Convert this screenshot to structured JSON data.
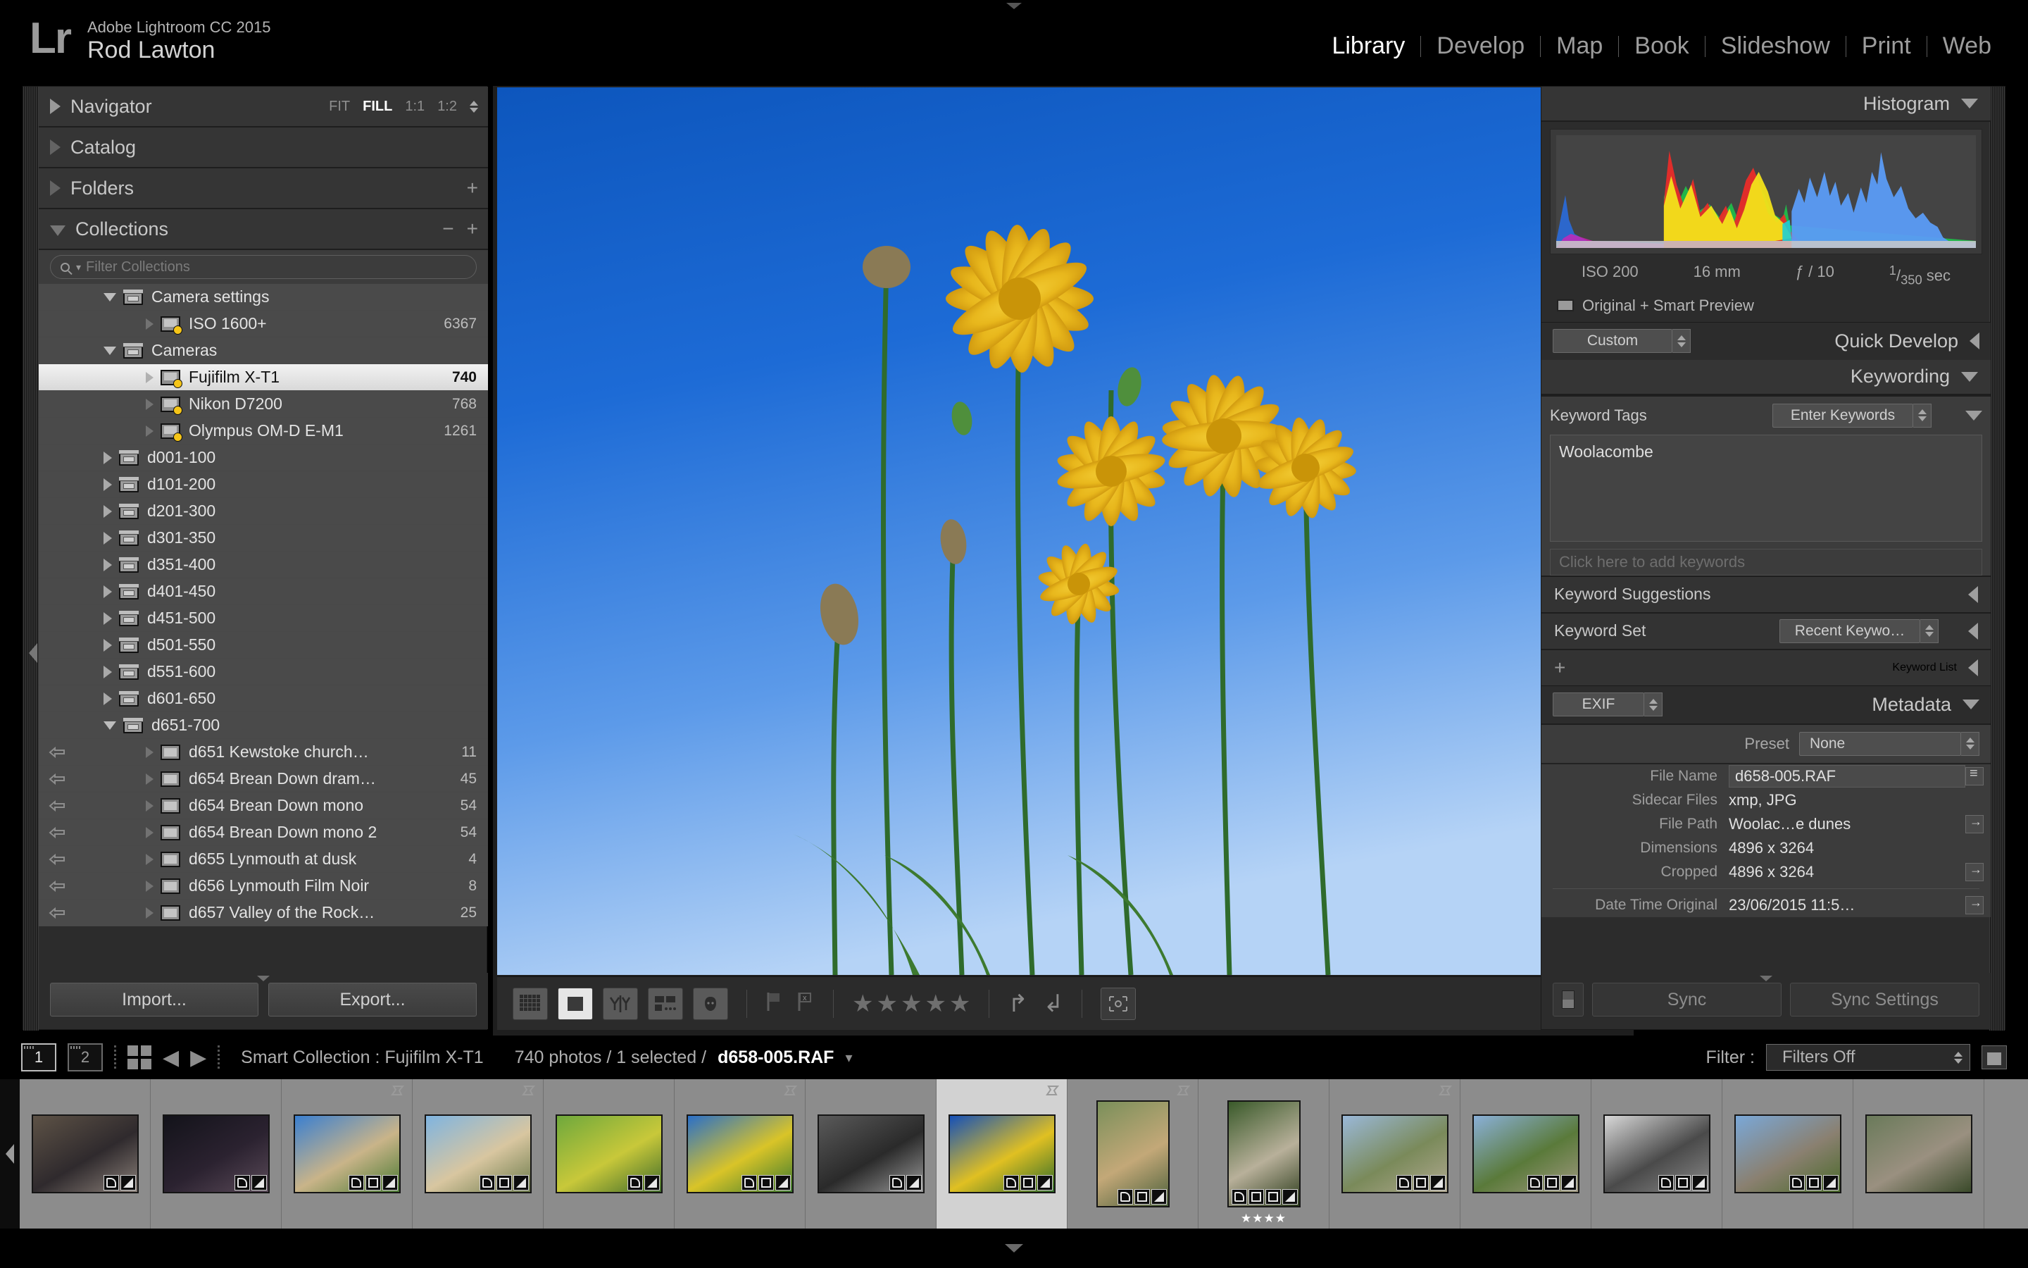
{
  "app": {
    "logo": "Lr",
    "product": "Adobe Lightroom CC 2015",
    "user": "Rod Lawton"
  },
  "modules": [
    {
      "label": "Library",
      "active": true
    },
    {
      "label": "Develop",
      "active": false
    },
    {
      "label": "Map",
      "active": false
    },
    {
      "label": "Book",
      "active": false
    },
    {
      "label": "Slideshow",
      "active": false
    },
    {
      "label": "Print",
      "active": false
    },
    {
      "label": "Web",
      "active": false
    }
  ],
  "left_panel": {
    "navigator": {
      "title": "Navigator",
      "zoom_options": [
        {
          "label": "FIT",
          "active": false
        },
        {
          "label": "FILL",
          "active": true
        },
        {
          "label": "1:1",
          "active": false
        },
        {
          "label": "1:2",
          "active": false
        }
      ]
    },
    "catalog": {
      "title": "Catalog"
    },
    "folders": {
      "title": "Folders"
    },
    "collections": {
      "title": "Collections",
      "filter_placeholder": "Filter Collections",
      "items": [
        {
          "label": "Camera settings",
          "count": "",
          "type": "set",
          "twist": "down",
          "indent": 1,
          "selected": false,
          "sync": false
        },
        {
          "label": "ISO 1600+",
          "count": "6367",
          "type": "smart",
          "twist": "dot",
          "indent": 2,
          "selected": false,
          "sync": false
        },
        {
          "label": "Cameras",
          "count": "",
          "type": "set",
          "twist": "down",
          "indent": 1,
          "selected": false,
          "sync": false
        },
        {
          "label": "Fujifilm X-T1",
          "count": "740",
          "type": "smart",
          "twist": "dot",
          "indent": 2,
          "selected": true,
          "sync": false
        },
        {
          "label": "Nikon D7200",
          "count": "768",
          "type": "smart",
          "twist": "dot",
          "indent": 2,
          "selected": false,
          "sync": false
        },
        {
          "label": "Olympus OM-D E-M1",
          "count": "1261",
          "type": "smart",
          "twist": "dot",
          "indent": 2,
          "selected": false,
          "sync": false
        },
        {
          "label": "d001-100",
          "count": "",
          "type": "set",
          "twist": "right",
          "indent": 1,
          "selected": false,
          "sync": false
        },
        {
          "label": "d101-200",
          "count": "",
          "type": "set",
          "twist": "right",
          "indent": 1,
          "selected": false,
          "sync": false
        },
        {
          "label": "d201-300",
          "count": "",
          "type": "set",
          "twist": "right",
          "indent": 1,
          "selected": false,
          "sync": false
        },
        {
          "label": "d301-350",
          "count": "",
          "type": "set",
          "twist": "right",
          "indent": 1,
          "selected": false,
          "sync": false
        },
        {
          "label": "d351-400",
          "count": "",
          "type": "set",
          "twist": "right",
          "indent": 1,
          "selected": false,
          "sync": false
        },
        {
          "label": "d401-450",
          "count": "",
          "type": "set",
          "twist": "right",
          "indent": 1,
          "selected": false,
          "sync": false
        },
        {
          "label": "d451-500",
          "count": "",
          "type": "set",
          "twist": "right",
          "indent": 1,
          "selected": false,
          "sync": false
        },
        {
          "label": "d501-550",
          "count": "",
          "type": "set",
          "twist": "right",
          "indent": 1,
          "selected": false,
          "sync": false
        },
        {
          "label": "d551-600",
          "count": "",
          "type": "set",
          "twist": "right",
          "indent": 1,
          "selected": false,
          "sync": false
        },
        {
          "label": "d601-650",
          "count": "",
          "type": "set",
          "twist": "right",
          "indent": 1,
          "selected": false,
          "sync": false
        },
        {
          "label": "d651-700",
          "count": "",
          "type": "set",
          "twist": "down",
          "indent": 1,
          "selected": false,
          "sync": false
        },
        {
          "label": "d651 Kewstoke church…",
          "count": "11",
          "type": "coll",
          "twist": "dot",
          "indent": 2,
          "selected": false,
          "sync": true
        },
        {
          "label": "d654 Brean Down dram…",
          "count": "45",
          "type": "coll",
          "twist": "dot",
          "indent": 2,
          "selected": false,
          "sync": true
        },
        {
          "label": "d654 Brean Down mono",
          "count": "54",
          "type": "coll",
          "twist": "dot",
          "indent": 2,
          "selected": false,
          "sync": true
        },
        {
          "label": "d654 Brean Down mono 2",
          "count": "54",
          "type": "coll",
          "twist": "dot",
          "indent": 2,
          "selected": false,
          "sync": true
        },
        {
          "label": "d655 Lynmouth at dusk",
          "count": "4",
          "type": "coll",
          "twist": "dot",
          "indent": 2,
          "selected": false,
          "sync": true
        },
        {
          "label": "d656 Lynmouth Film Noir",
          "count": "8",
          "type": "coll",
          "twist": "dot",
          "indent": 2,
          "selected": false,
          "sync": true
        },
        {
          "label": "d657 Valley of the Rock…",
          "count": "25",
          "type": "coll",
          "twist": "dot",
          "indent": 2,
          "selected": false,
          "sync": true
        }
      ]
    },
    "import_label": "Import...",
    "export_label": "Export..."
  },
  "toolbar": {
    "views": [
      {
        "name": "grid-view",
        "active": false
      },
      {
        "name": "loupe-view",
        "active": true
      },
      {
        "name": "compare-view",
        "active": false
      },
      {
        "name": "survey-view",
        "active": false
      },
      {
        "name": "people-view",
        "active": false
      }
    ],
    "flag_label": "flag",
    "reject_label": "reject",
    "stars": "★★★★★",
    "rotate_left": "↰",
    "rotate_right": "↲"
  },
  "right_panel": {
    "histogram": {
      "title": "Histogram",
      "iso": "ISO 200",
      "focal": "16 mm",
      "aperture": "ƒ / 10",
      "shutter_num": "1",
      "shutter_den": "350",
      "shutter_unit": "sec",
      "preview_state": "Original + Smart Preview"
    },
    "quick_develop": {
      "title": "Quick Develop",
      "preset": "Custom"
    },
    "keywording": {
      "title": "Keywording",
      "tags_label": "Keyword Tags",
      "tags_mode": "Enter Keywords",
      "keywords": "Woolacombe",
      "add_placeholder": "Click here to add keywords",
      "suggestions_title": "Keyword Suggestions",
      "set_label": "Keyword Set",
      "set_value": "Recent Keywo…"
    },
    "keyword_list": {
      "title": "Keyword List",
      "add": "+"
    },
    "metadata": {
      "title": "Metadata",
      "mode": "EXIF",
      "preset_label": "Preset",
      "preset_value": "None",
      "fields": [
        {
          "key": "File Name",
          "value": "d658-005.RAF",
          "boxed": true,
          "button": "list"
        },
        {
          "key": "Sidecar Files",
          "value": "xmp, JPG",
          "boxed": false,
          "button": ""
        },
        {
          "key": "File Path",
          "value": "Woolac…e dunes",
          "boxed": false,
          "button": "arrow"
        },
        {
          "key": "Dimensions",
          "value": "4896 x 3264",
          "boxed": false,
          "button": ""
        },
        {
          "key": "Cropped",
          "value": "4896 x 3264",
          "boxed": false,
          "button": "arrow"
        },
        {
          "key": "Date Time Original",
          "value": "23/06/2015 11:5…",
          "boxed": false,
          "button": "arrow"
        }
      ]
    },
    "sync_label": "Sync",
    "sync_settings_label": "Sync Settings"
  },
  "statusbar": {
    "view1": "1",
    "view2": "2",
    "source": "Smart Collection : Fujifilm X-T1",
    "counts": "740 photos / 1 selected /",
    "current_file": "d658-005.RAF",
    "filter_label": "Filter :",
    "filter_value": "Filters Off"
  },
  "filmstrip": {
    "thumbnails": [
      {
        "name": "river-gorge-dusk",
        "orient": "landscape",
        "selected": false,
        "flag": false,
        "stars": "",
        "badges": [
          "tag",
          "dev"
        ],
        "colors": [
          "#5d5246",
          "#2f2a2d",
          "#8a7f78"
        ]
      },
      {
        "name": "village-stream-night",
        "orient": "landscape",
        "selected": false,
        "flag": false,
        "stars": "",
        "badges": [
          "tag",
          "dev"
        ],
        "colors": [
          "#13131a",
          "#2b2230",
          "#5a4a58"
        ]
      },
      {
        "name": "dune-grass-flowers",
        "orient": "landscape",
        "selected": false,
        "flag": true,
        "stars": "",
        "badges": [
          "tag",
          "crop",
          "dev"
        ],
        "colors": [
          "#3a7fd0",
          "#c9b489",
          "#4a7a33"
        ]
      },
      {
        "name": "beach-dunes-bay",
        "orient": "landscape",
        "selected": false,
        "flag": true,
        "stars": "",
        "badges": [
          "tag",
          "crop",
          "dev"
        ],
        "colors": [
          "#7fb4e0",
          "#d8c6a0",
          "#6b7a4a"
        ]
      },
      {
        "name": "yellow-meadow",
        "orient": "landscape",
        "selected": false,
        "flag": false,
        "stars": "",
        "badges": [
          "tag",
          "dev"
        ],
        "colors": [
          "#6ea83c",
          "#c8c83a",
          "#3f6b2a"
        ]
      },
      {
        "name": "dandelions-blue-sky",
        "orient": "landscape",
        "selected": false,
        "flag": true,
        "stars": "",
        "badges": [
          "tag",
          "crop",
          "dev"
        ],
        "colors": [
          "#2a6fc8",
          "#d9c428",
          "#3c7a2e"
        ]
      },
      {
        "name": "mono-grass-field",
        "orient": "landscape",
        "selected": false,
        "flag": false,
        "stars": "",
        "badges": [
          "tag",
          "dev"
        ],
        "colors": [
          "#5a5a5a",
          "#2a2a2a",
          "#9a9a9a"
        ]
      },
      {
        "name": "dandelion-sky-selected",
        "orient": "landscape",
        "selected": true,
        "flag": true,
        "stars": "",
        "badges": [
          "tag",
          "crop",
          "dev"
        ],
        "colors": [
          "#1550b8",
          "#e0c022",
          "#2f6b2a"
        ]
      },
      {
        "name": "coast-path-hill",
        "orient": "portrait",
        "selected": false,
        "flag": true,
        "stars": "",
        "badges": [
          "tag",
          "crop",
          "dev"
        ],
        "colors": [
          "#7a8f5a",
          "#c3a878",
          "#4a5f3a"
        ]
      },
      {
        "name": "churchyard-gate",
        "orient": "portrait",
        "selected": false,
        "flag": false,
        "stars": "★★★★",
        "badges": [
          "tag",
          "crop",
          "sq",
          "dev"
        ],
        "colors": [
          "#3a5a2a",
          "#b8b09a",
          "#2a3a1a"
        ]
      },
      {
        "name": "church-graveyard",
        "orient": "landscape",
        "selected": false,
        "flag": true,
        "stars": "",
        "badges": [
          "tag",
          "crop",
          "dev"
        ],
        "colors": [
          "#9ab8d8",
          "#7a8a5a",
          "#b0a890"
        ]
      },
      {
        "name": "churchyard-trees",
        "orient": "landscape",
        "selected": false,
        "flag": false,
        "stars": "",
        "badges": [
          "tag",
          "crop",
          "dev"
        ],
        "colors": [
          "#8ab0d8",
          "#5a7a3a",
          "#a09880"
        ]
      },
      {
        "name": "mono-church-tower",
        "orient": "landscape",
        "selected": false,
        "flag": false,
        "stars": "",
        "badges": [
          "tag",
          "crop",
          "dev"
        ],
        "colors": [
          "#d8d8d8",
          "#4a4a4a",
          "#8a8a8a"
        ]
      },
      {
        "name": "ruined-chapel",
        "orient": "landscape",
        "selected": false,
        "flag": false,
        "stars": "",
        "badges": [
          "tag",
          "crop",
          "dev"
        ],
        "colors": [
          "#7aa8d8",
          "#8a8070",
          "#4a6a2a"
        ]
      },
      {
        "name": "stone-wall-ruin",
        "orient": "landscape",
        "selected": false,
        "flag": false,
        "stars": "",
        "badges": [],
        "colors": [
          "#6a7a5a",
          "#9a9080",
          "#3a4a2a"
        ]
      }
    ]
  }
}
